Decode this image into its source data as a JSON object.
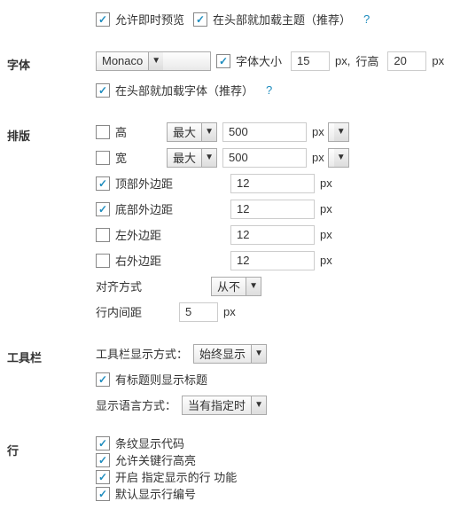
{
  "top": {
    "allow_live_preview": "允许即时预览",
    "load_theme_in_head": "在头部就加载主题（推荐）"
  },
  "font": {
    "section": "字体",
    "family": "Monaco",
    "size_label": "字体大小",
    "size": "15",
    "px": "px,",
    "lineheight_label": "行高",
    "lineheight": "20",
    "px2": "px",
    "load_font_in_head": "在头部就加载字体（推荐）"
  },
  "layout": {
    "section": "排版",
    "height_label": "高",
    "width_label": "宽",
    "max": "最大",
    "height_val": "500",
    "width_val": "500",
    "margin_top_label": "顶部外边距",
    "margin_top_val": "12",
    "margin_bottom_label": "底部外边距",
    "margin_bottom_val": "12",
    "margin_left_label": "左外边距",
    "margin_left_val": "12",
    "margin_right_label": "右外边距",
    "margin_right_val": "12",
    "px": "px",
    "align_label": "对齐方式",
    "align_val": "从不",
    "inline_spacing_label": "行内间距",
    "inline_spacing_val": "5"
  },
  "toolbar": {
    "section": "工具栏",
    "display_label": "工具栏显示方式：",
    "display_val": "始终显示",
    "title_if_exists": "有标题则显示标题",
    "lang_label": "显示语言方式：",
    "lang_val": "当有指定时"
  },
  "lines": {
    "section": "行",
    "stripe": "条纹显示代码",
    "highlight": "允许关键行高亮",
    "enable_line": "开启 指定显示的行 功能",
    "default_num": "默认显示行编号"
  },
  "help": "?"
}
